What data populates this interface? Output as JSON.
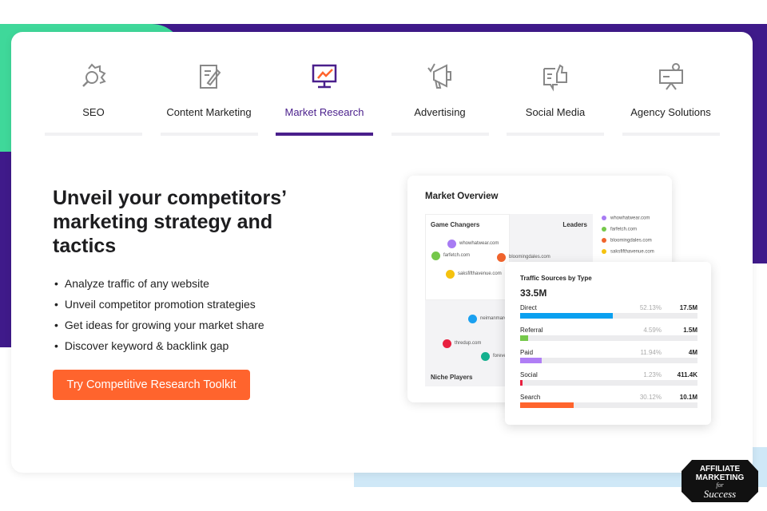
{
  "colors": {
    "accent": "#4a1f8c",
    "cta": "#ff642d",
    "green": "#3fd89a",
    "lightblue": "#cfe8f7"
  },
  "tabs": [
    {
      "label": "SEO",
      "icon": "seo-gear-magnifier-icon",
      "active": false
    },
    {
      "label": "Content Marketing",
      "icon": "document-pencil-icon",
      "active": false
    },
    {
      "label": "Market Research",
      "icon": "monitor-chart-icon",
      "active": true
    },
    {
      "label": "Advertising",
      "icon": "megaphone-icon",
      "active": false
    },
    {
      "label": "Social Media",
      "icon": "thumbs-up-chat-icon",
      "active": false
    },
    {
      "label": "Agency Solutions",
      "icon": "presenter-board-icon",
      "active": false
    }
  ],
  "hero": {
    "title": "Unveil your competitors’ marketing strategy and tactics",
    "bullets": [
      "Analyze traffic of any website",
      "Unveil competitor promotion strategies",
      "Get ideas for growing your market share",
      "Discover keyword & backlink gap"
    ],
    "cta": "Try Competitive Research Toolkit"
  },
  "market_overview": {
    "title": "Market Overview",
    "quadrants": {
      "top_left": "Game Changers",
      "top_right": "Leaders",
      "bottom_left": "Niche Players"
    },
    "points": [
      {
        "label": "whowhatwear.com",
        "color": "#a77bf3"
      },
      {
        "label": "farfetch.com",
        "color": "#75c84a"
      },
      {
        "label": "bloomingdales.com",
        "color": "#f0642d"
      },
      {
        "label": "saksfifthavenue.com",
        "color": "#f5c20f"
      },
      {
        "label": "neimanmarcu",
        "color": "#1aa0f0"
      },
      {
        "label": "thredup.com",
        "color": "#e8203f"
      },
      {
        "label": "foreve",
        "color": "#13b08e"
      }
    ],
    "legend": [
      "whowhatwear.com",
      "farfetch.com",
      "bloomingdales.com",
      "saksfifthavenue.com"
    ]
  },
  "traffic": {
    "title": "Traffic Sources by Type",
    "total": "33.5M",
    "rows": [
      {
        "name": "Direct",
        "pct": "52.13%",
        "value": "17.5M",
        "fraction": 0.5213,
        "color": "#0aa0f0"
      },
      {
        "name": "Referral",
        "pct": "4.59%",
        "value": "1.5M",
        "fraction": 0.0459,
        "color": "#75c84a"
      },
      {
        "name": "Paid",
        "pct": "11.94%",
        "value": "4M",
        "fraction": 0.1194,
        "color": "#b07ef5"
      },
      {
        "name": "Social",
        "pct": "1.23%",
        "value": "411.4K",
        "fraction": 0.0123,
        "color": "#e8203f"
      },
      {
        "name": "Search",
        "pct": "30.12%",
        "value": "10.1M",
        "fraction": 0.3012,
        "color": "#ff642d"
      }
    ]
  },
  "badge": {
    "line1": "AFFILIATE",
    "line2": "MARKETING",
    "line3": "for",
    "line4": "Success"
  }
}
